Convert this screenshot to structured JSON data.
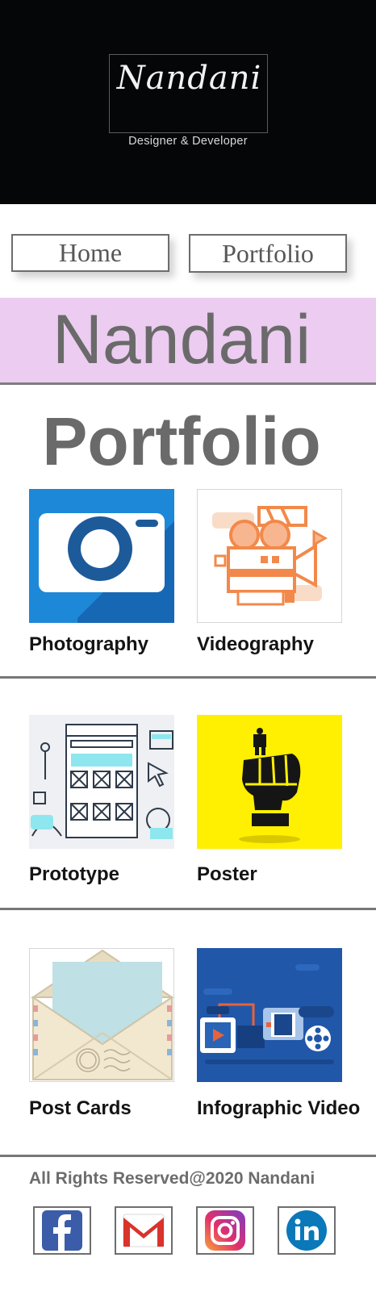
{
  "header": {
    "logo_name": "Nandani",
    "logo_tagline": "Designer & Developer"
  },
  "nav": {
    "home_label": "Home",
    "portfolio_label": "Portfolio"
  },
  "banner": {
    "name": "Nandani"
  },
  "section": {
    "title": "Portfolio"
  },
  "gallery": {
    "items": [
      {
        "label": "Photography",
        "icon": "camera-icon"
      },
      {
        "label": "Videography",
        "icon": "film-projector-icon"
      },
      {
        "label": "Prototype",
        "icon": "wireframe-icon"
      },
      {
        "label": "Poster",
        "icon": "raised-fist-icon"
      },
      {
        "label": "Post Cards",
        "icon": "envelope-icon"
      },
      {
        "label": "Infographic Video",
        "icon": "media-player-icon"
      }
    ]
  },
  "footer": {
    "copyright": "All Rights Reserved@2020 Nandani",
    "social": [
      {
        "name": "facebook-icon"
      },
      {
        "name": "gmail-icon"
      },
      {
        "name": "instagram-icon"
      },
      {
        "name": "linkedin-icon"
      }
    ]
  },
  "colors": {
    "header_bg": "#050607",
    "banner_bg": "#ecccf0",
    "text_gray": "#6a6a6a",
    "photo_blue": "#1e88d8",
    "poster_yellow": "#ffef00",
    "infographic_blue": "#2157a8"
  }
}
